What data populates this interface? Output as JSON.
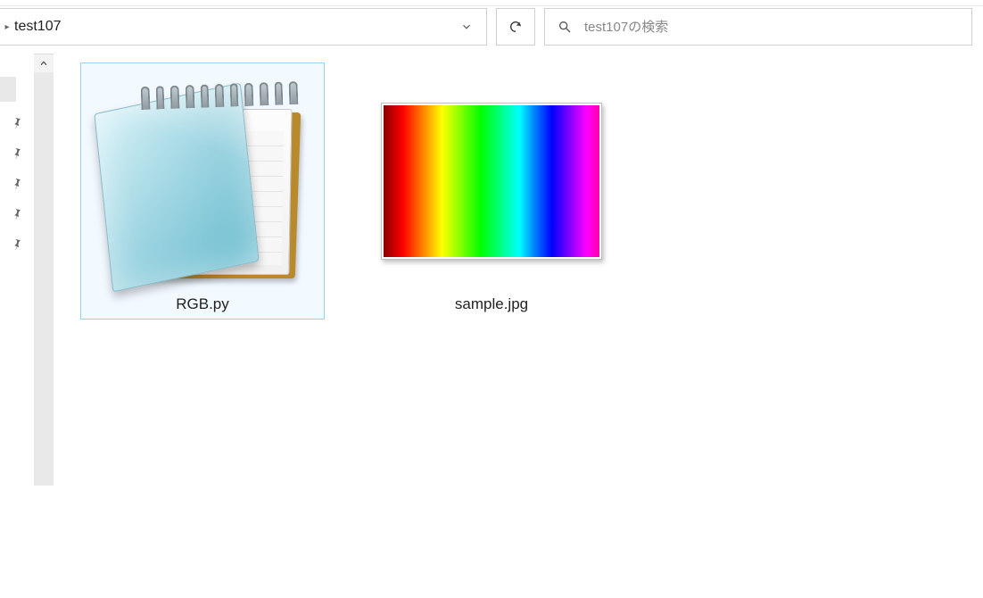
{
  "addressbar": {
    "path": "test107"
  },
  "search": {
    "placeholder": "test107の検索"
  },
  "sidebar": {
    "pins": [
      {
        "name": "pin-1"
      },
      {
        "name": "pin-2"
      },
      {
        "name": "pin-3"
      },
      {
        "name": "pin-4"
      },
      {
        "name": "pin-5"
      }
    ]
  },
  "files": [
    {
      "name": "RGB.py",
      "icon": "notepad-icon",
      "selected": true
    },
    {
      "name": "sample.jpg",
      "icon": "rainbow-thumbnail",
      "selected": false
    }
  ]
}
